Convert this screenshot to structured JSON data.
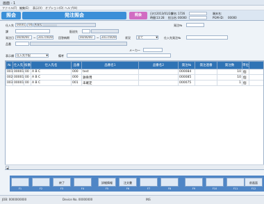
{
  "window": {
    "title": "画面 - 1"
  },
  "menu": [
    "ファイル(F)",
    "編集(E)",
    "表示(V)",
    "オプション(O)",
    "ヘルプ(H)"
  ],
  "header": {
    "left_pill": "照会",
    "title": "発注照会",
    "mode": "照会",
    "info": {
      "date_label": "日付:",
      "date_value": "2013/01/24",
      "staff_label": "課名:",
      "staff_value": "1726",
      "time_label": "時間:",
      "time_value": "13:28",
      "rep_label": "担当名:",
      "rep_value": "00000",
      "terminal_label": "端末名:",
      "terminal_value": "",
      "pgm_label": "PGM-ID:",
      "pgm_value": "00000"
    }
  },
  "form": {
    "supplier_label": "仕入先",
    "supplier_code": "00001",
    "supplier_sub": "00",
    "supplier_name": "A B C",
    "order_no_label": "発注№",
    "dept_label": "課",
    "delivery_label": "配送先",
    "order_date_label": "発注日",
    "order_date_from": "00/00/00",
    "order_date_to": "2017/00/00",
    "due_label": "回答納期",
    "due_from": "00/00/00",
    "due_to": "2017/00/00",
    "status_label": "状況",
    "status_value": "全て",
    "supplier_order_label": "仕入先発注№",
    "item_label": "品番",
    "maker_label": "メーカー",
    "sort_label": "表示順",
    "sort_value": "仕入先手配",
    "remarks_label": "備考"
  },
  "table": {
    "columns": [
      "№",
      "仕入先",
      "枝番",
      "仕入先名",
      "品番",
      "品番名1",
      "品番名2",
      "発注№",
      "発注連番",
      "発注数",
      "単位",
      "単"
    ],
    "rows": [
      [
        "001",
        "00001",
        "00",
        "A B C",
        "000",
        "test",
        "",
        "000084",
        "",
        "10",
        "個",
        ""
      ],
      [
        "002",
        "00001",
        "00",
        "A B C",
        "000",
        "鉄骨用",
        "",
        "000085",
        "",
        "10",
        "個",
        ""
      ],
      [
        "003",
        "00001",
        "00",
        "A B C",
        "001",
        "未確定",
        "",
        "000075",
        "",
        "1",
        "個",
        ""
      ]
    ]
  },
  "fkeys": [
    {
      "key": "F1",
      "label": ""
    },
    {
      "key": "F2",
      "label": ""
    },
    {
      "key": "F3",
      "label": "終了"
    },
    {
      "key": "F4",
      "label": ""
    },
    {
      "key": "F5",
      "label": "詳細情報"
    },
    {
      "key": "F6",
      "label": "注文書"
    },
    {
      "key": "F7",
      "label": ""
    },
    {
      "key": "F8",
      "label": ""
    },
    {
      "key": "F9",
      "label": ""
    },
    {
      "key": "F10",
      "label": ""
    },
    {
      "key": "F11",
      "label": ""
    },
    {
      "key": "F12",
      "label": "前画面"
    }
  ],
  "status": {
    "left": "JOB: 0000000000",
    "mid": "Device No. 00000000",
    "right": "INS"
  }
}
